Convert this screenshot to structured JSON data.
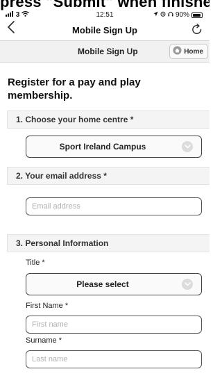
{
  "caption_crop": "press \"Submit\" when finished",
  "status_bar": {
    "carrier": "3",
    "time": "12:51",
    "battery": "90%",
    "battery_level": 0.9
  },
  "nav": {
    "title": "Mobile Sign Up"
  },
  "toolbar": {
    "title": "Mobile Sign Up",
    "home_label": "Home"
  },
  "form": {
    "heading": "Register for a pay and play membership.",
    "section1": {
      "title": "1. Choose your home centre *",
      "selected": "Sport Ireland Campus"
    },
    "section2": {
      "title": "2. Your email address *",
      "placeholder": "Email address"
    },
    "section3": {
      "title": "3. Personal Information",
      "title_label": "Title *",
      "title_select": "Please select",
      "first_name_label": "First Name *",
      "first_name_placeholder": "First name",
      "surname_label": "Surname *",
      "surname_placeholder": "Last name"
    }
  },
  "icons": {
    "back": "chevron-left-icon",
    "refresh": "refresh-icon",
    "home": "home-icon",
    "dropdown": "chevron-down-icon"
  }
}
